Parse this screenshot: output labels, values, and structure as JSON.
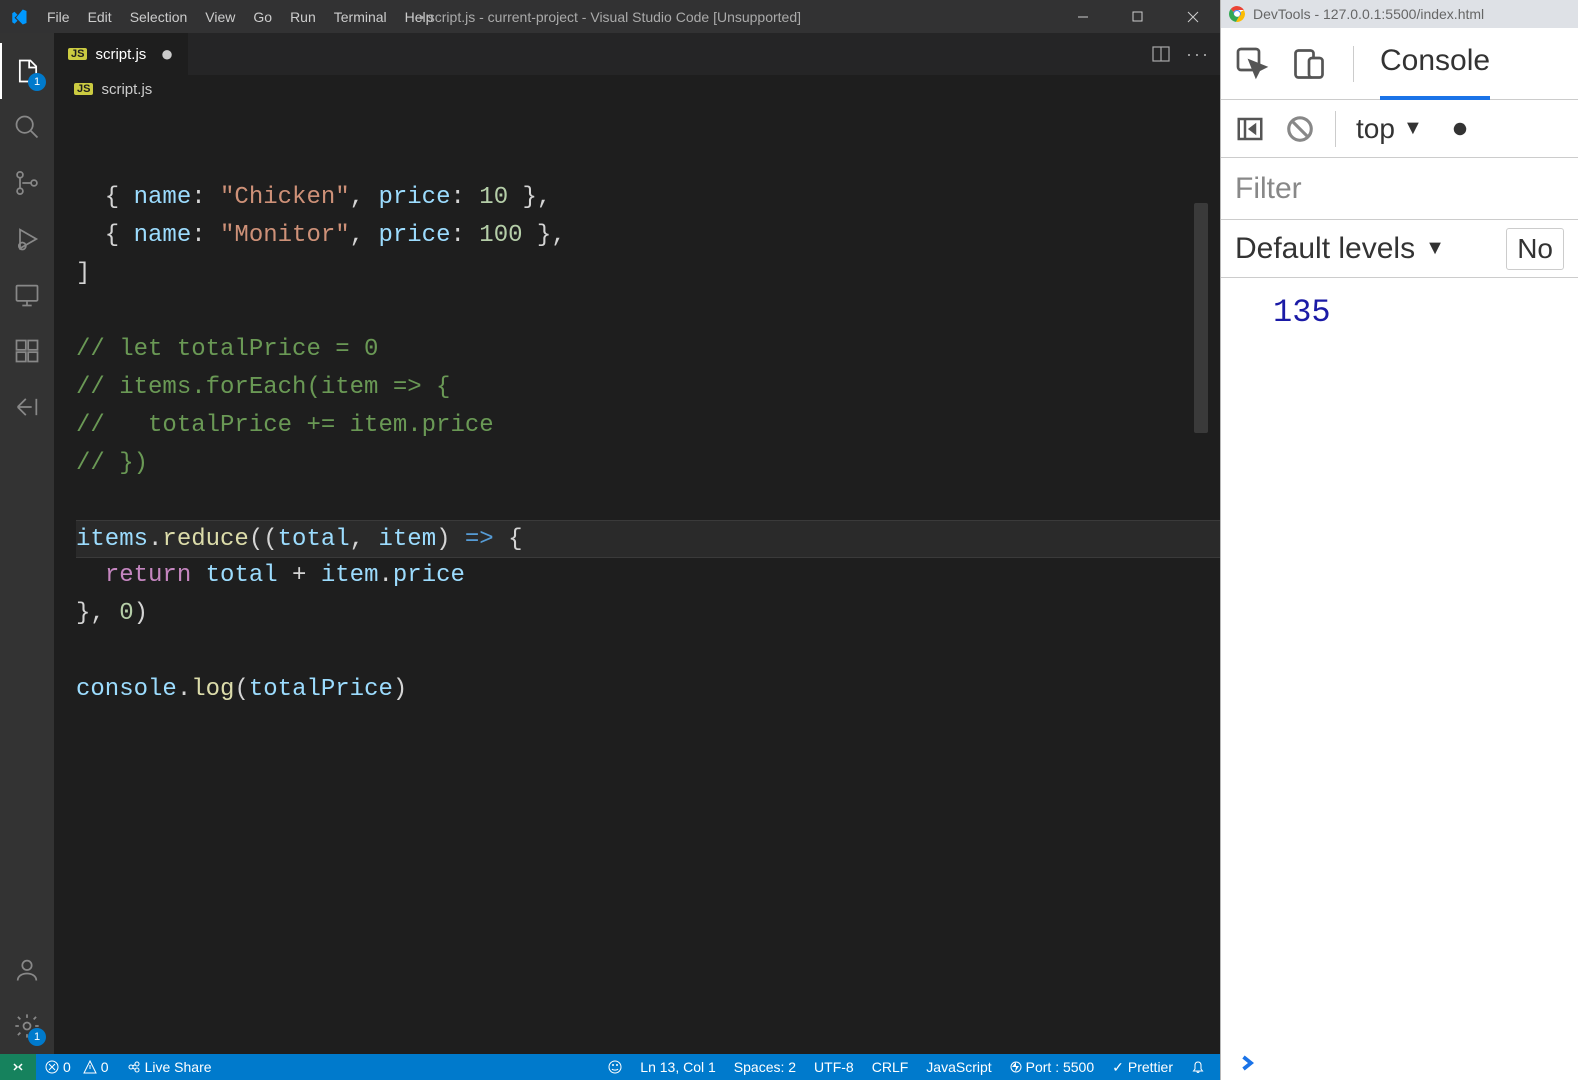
{
  "vscode": {
    "menus": [
      "File",
      "Edit",
      "Selection",
      "View",
      "Go",
      "Run",
      "Terminal",
      "Help"
    ],
    "window_title": "script.js - current-project - Visual Studio Code [Unsupported]",
    "tab": {
      "filename": "script.js",
      "lang_badge": "JS",
      "dirty": "●"
    },
    "breadcrumb": {
      "lang_badge": "JS",
      "path": "script.js"
    },
    "code_lines": [
      {
        "type": "code",
        "tokens": [
          {
            "t": "  { ",
            "c": "punc"
          },
          {
            "t": "name",
            "c": "prop"
          },
          {
            "t": ": ",
            "c": "punc"
          },
          {
            "t": "\"Chicken\"",
            "c": "str"
          },
          {
            "t": ", ",
            "c": "punc"
          },
          {
            "t": "price",
            "c": "prop"
          },
          {
            "t": ": ",
            "c": "punc"
          },
          {
            "t": "10",
            "c": "num"
          },
          {
            "t": " },",
            "c": "punc"
          }
        ]
      },
      {
        "type": "code",
        "tokens": [
          {
            "t": "  { ",
            "c": "punc"
          },
          {
            "t": "name",
            "c": "prop"
          },
          {
            "t": ": ",
            "c": "punc"
          },
          {
            "t": "\"Monitor\"",
            "c": "str"
          },
          {
            "t": ", ",
            "c": "punc"
          },
          {
            "t": "price",
            "c": "prop"
          },
          {
            "t": ": ",
            "c": "punc"
          },
          {
            "t": "100",
            "c": "num"
          },
          {
            "t": " },",
            "c": "punc"
          }
        ]
      },
      {
        "type": "code",
        "tokens": [
          {
            "t": "]",
            "c": "punc"
          }
        ]
      },
      {
        "type": "blank"
      },
      {
        "type": "comment",
        "text": "// let totalPrice = 0"
      },
      {
        "type": "comment",
        "text": "// items.forEach(item => {"
      },
      {
        "type": "comment",
        "text": "//   totalPrice += item.price"
      },
      {
        "type": "comment",
        "text": "// })"
      },
      {
        "type": "blank"
      },
      {
        "type": "code",
        "current": true,
        "tokens": [
          {
            "t": "items",
            "c": "var"
          },
          {
            "t": ".",
            "c": "punc"
          },
          {
            "t": "reduce",
            "c": "func"
          },
          {
            "t": "((",
            "c": "punc"
          },
          {
            "t": "total",
            "c": "var"
          },
          {
            "t": ", ",
            "c": "punc"
          },
          {
            "t": "item",
            "c": "var"
          },
          {
            "t": ") ",
            "c": "punc"
          },
          {
            "t": "=>",
            "c": "arrow"
          },
          {
            "t": " {",
            "c": "punc"
          }
        ]
      },
      {
        "type": "code",
        "tokens": [
          {
            "t": "  ",
            "c": "punc"
          },
          {
            "t": "return",
            "c": "kw"
          },
          {
            "t": " ",
            "c": "punc"
          },
          {
            "t": "total",
            "c": "var"
          },
          {
            "t": " + ",
            "c": "punc"
          },
          {
            "t": "item",
            "c": "var"
          },
          {
            "t": ".",
            "c": "punc"
          },
          {
            "t": "price",
            "c": "var"
          }
        ]
      },
      {
        "type": "code",
        "tokens": [
          {
            "t": "}, ",
            "c": "punc"
          },
          {
            "t": "0",
            "c": "num"
          },
          {
            "t": ")",
            "c": "punc"
          }
        ]
      },
      {
        "type": "blank"
      },
      {
        "type": "code",
        "tokens": [
          {
            "t": "console",
            "c": "var"
          },
          {
            "t": ".",
            "c": "punc"
          },
          {
            "t": "log",
            "c": "func"
          },
          {
            "t": "(",
            "c": "punc"
          },
          {
            "t": "totalPrice",
            "c": "var"
          },
          {
            "t": ")",
            "c": "punc"
          }
        ]
      }
    ],
    "activity_badge": "1",
    "settings_badge": "1",
    "status": {
      "errors": "0",
      "warnings": "0",
      "live_share": "Live Share",
      "ln_col": "Ln 13, Col 1",
      "spaces": "Spaces: 2",
      "encoding": "UTF-8",
      "eol": "CRLF",
      "lang": "JavaScript",
      "port": "Port : 5500",
      "prettier": "Prettier"
    }
  },
  "devtools": {
    "title": "DevTools - 127.0.0.1:5500/index.html",
    "console_tab": "Console",
    "context": "top",
    "filter_placeholder": "Filter",
    "levels_label": "Default levels",
    "side_btn": "No",
    "messages": [
      "135"
    ]
  }
}
